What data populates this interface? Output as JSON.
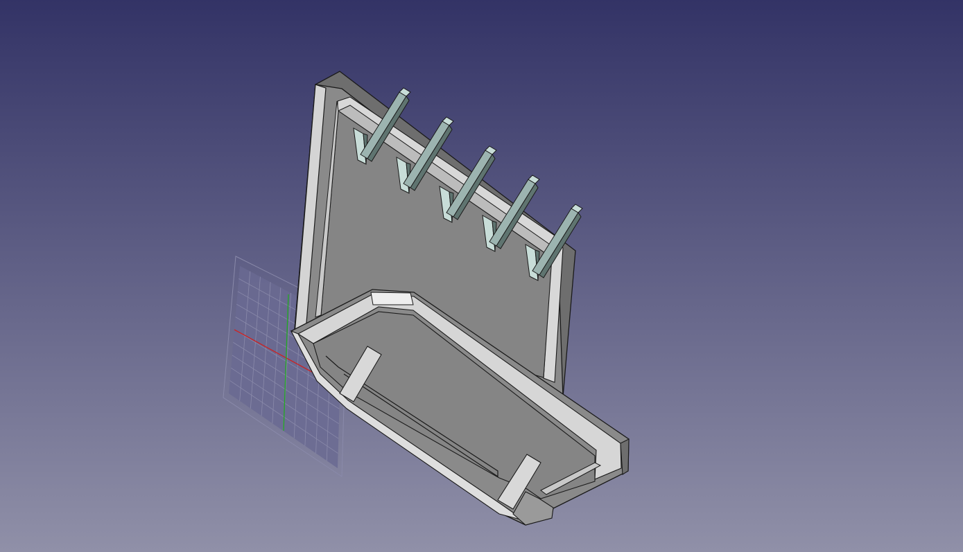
{
  "viewport": {
    "background_top": "#333366",
    "background_bottom": "#9090a8"
  },
  "model": {
    "icon": "connector-3d-model-icon",
    "body_color": "#8a8a8a",
    "body_dark": "#6e6e6e",
    "edge_light": "#d4d4d4",
    "edge_white": "#eeeeee",
    "outline": "#1a1a1a",
    "pin_color": "#9cb4b0",
    "pin_light": "#c8ddd8",
    "pin_dark": "#5f7470",
    "pin_count": 5
  },
  "grid": {
    "icon": "sketch-grid-icon",
    "fill": "#6a6a92",
    "line_color": "#8a8aaa",
    "x_axis_color": "#cc2222",
    "y_axis_color": "#22aa22"
  }
}
